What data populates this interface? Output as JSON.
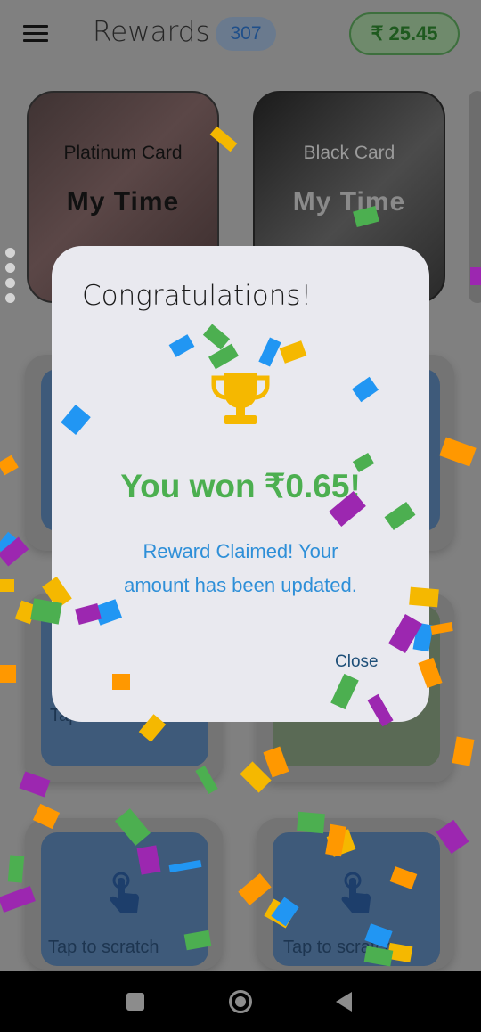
{
  "header": {
    "title": "Rewards",
    "count": "307",
    "balance_symbol": "₹",
    "balance": "25.45"
  },
  "cards": [
    {
      "type": "Platinum Card",
      "name": "My Time"
    },
    {
      "type": "Black Card",
      "name": "My Time"
    }
  ],
  "tiles": {
    "tap_short": "Tap",
    "tap_label": "Tap to scratch"
  },
  "dialog": {
    "title": "Congratulations!",
    "won": "You won ₹0.65!",
    "claim_line1": "Reward Claimed! Your",
    "claim_line2": "amount has been updated.",
    "close": "Close"
  },
  "colors": {
    "accent_green": "#4caf50",
    "accent_blue": "#2e8fd8",
    "trophy": "#f5b800",
    "confetti": [
      "#f5b800",
      "#2196f3",
      "#4caf50",
      "#9c27b0",
      "#ff9800"
    ]
  },
  "icons": {
    "menu": "menu-icon",
    "trophy": "trophy-icon",
    "tap": "tap-hand-icon",
    "nav_recents": "recents-square-icon",
    "nav_home": "home-circle-icon",
    "nav_back": "back-triangle-icon"
  }
}
